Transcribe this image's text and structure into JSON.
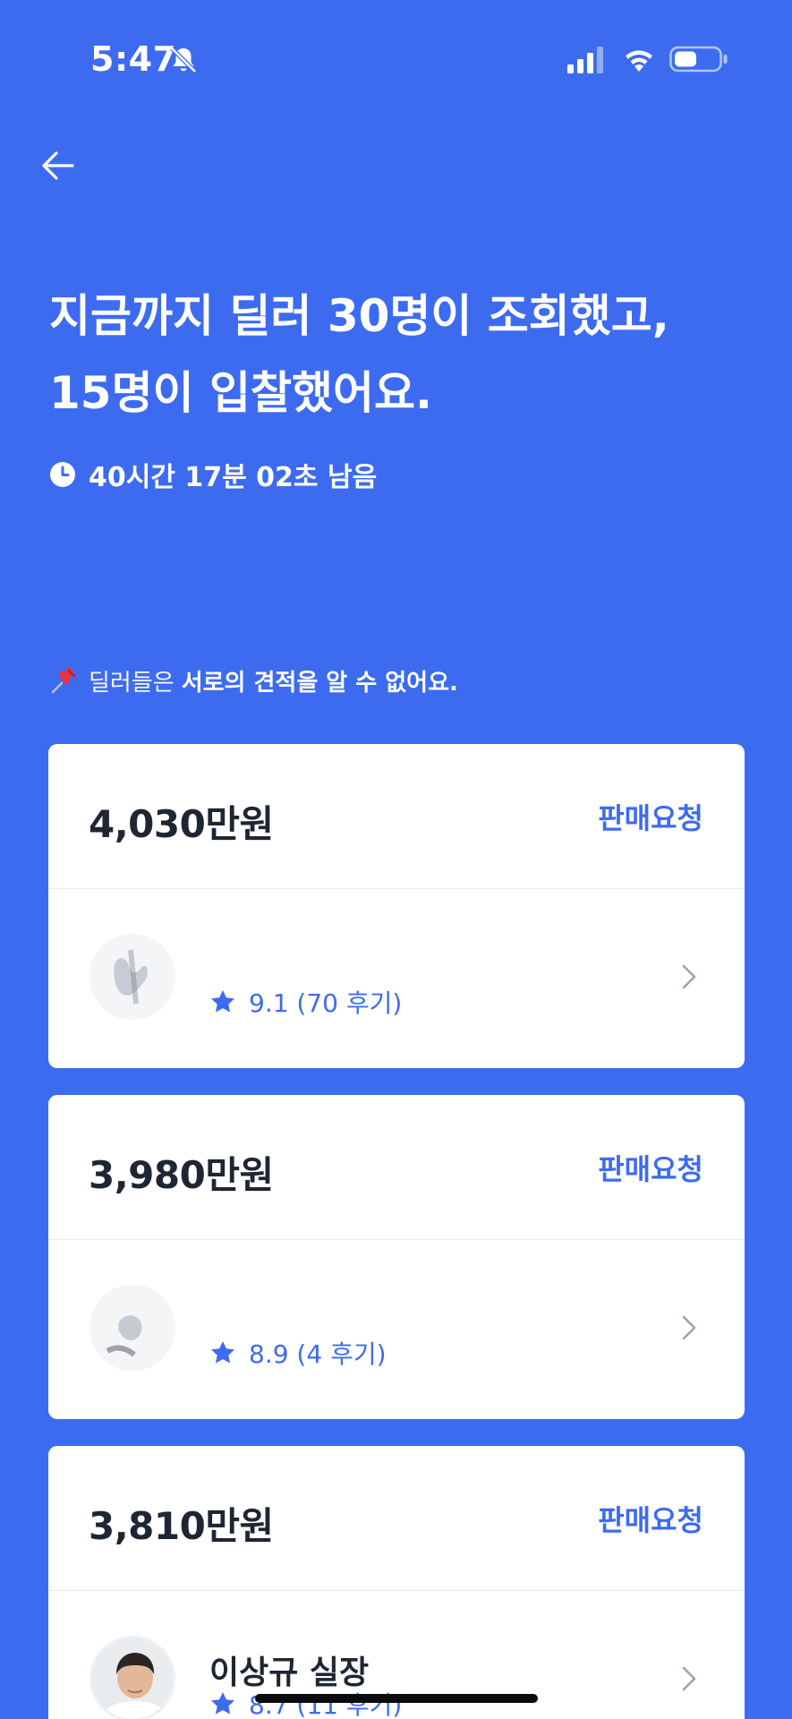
{
  "status_bar": {
    "time": "5:47",
    "icons": [
      "bell-off-icon",
      "signal-icon",
      "wifi-icon",
      "battery-icon"
    ]
  },
  "nav": {
    "back_icon": "arrow-left-icon"
  },
  "header": {
    "headline_line1": "지금까지 딜러 30명이 조회했고,",
    "headline_line2": "15명이 입찰했어요.",
    "timer_text": "40시간 17분 02초 남음"
  },
  "notice": {
    "prefix": "딜러들은",
    "emphasis": "서로의 견적을 알 수 없어요."
  },
  "bids": [
    {
      "price": "4,030만원",
      "action_label": "판매요청",
      "dealer_name": "",
      "rating": "9.1 (70 후기)"
    },
    {
      "price": "3,980만원",
      "action_label": "판매요청",
      "dealer_name": "",
      "rating": "8.9 (4 후기)"
    },
    {
      "price": "3,810만원",
      "action_label": "판매요청",
      "dealer_name": "이상규 실장",
      "rating": "8.7 (11 후기)"
    }
  ],
  "colors": {
    "background": "#3D6BF0",
    "card": "#FFFFFF",
    "accent": "#3D6BF0",
    "text_dark": "#1F2633",
    "divider": "#E7E9EE"
  }
}
